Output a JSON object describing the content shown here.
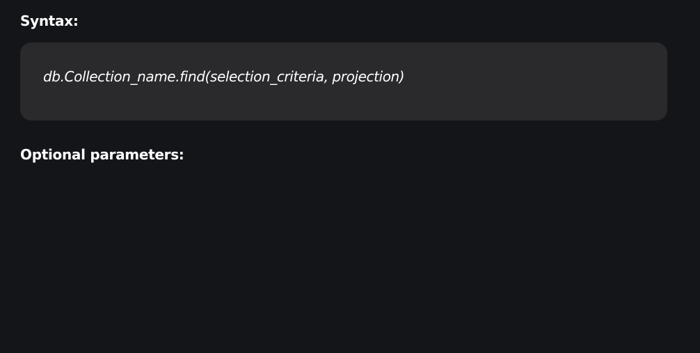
{
  "sections": {
    "syntax_heading": "Syntax:",
    "code": "db.Collection_name.find(selection_criteria, projection)",
    "optional_heading": "Optional parameters:"
  },
  "colors": {
    "background": "#141518",
    "code_block_background": "#2a2a2c",
    "text": "#ffffff"
  }
}
